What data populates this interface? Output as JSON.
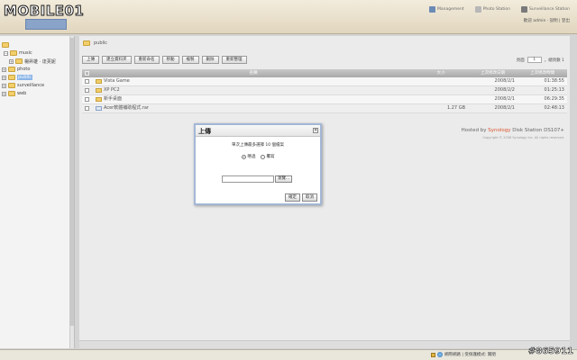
{
  "header": {
    "logo_text": "MOBILE01",
    "logo_sub": "",
    "links": [
      {
        "label": "Management",
        "icon": "management-icon",
        "color": "#6b8bb5"
      },
      {
        "label": "Photo Station",
        "icon": "photo-icon",
        "color": "#b7b7b7"
      },
      {
        "label": "Surveillance Station",
        "icon": "surveillance-icon",
        "color": "#7a7a7a"
      }
    ],
    "user_line": "歡迎 admin · 說明 | 登出"
  },
  "tree": {
    "items": [
      {
        "label": "",
        "level": 0,
        "icon": "folder-icon"
      },
      {
        "label": "music",
        "level": 1,
        "icon": "folder-icon"
      },
      {
        "label": "楊昇雄 · 達芙妮",
        "level": 2,
        "icon": "folder-icon"
      },
      {
        "label": "photo",
        "level": 1,
        "icon": "folder-icon"
      },
      {
        "label": "public",
        "level": 1,
        "icon": "folder-icon",
        "selected": true
      },
      {
        "label": "surveillance",
        "level": 1,
        "icon": "folder-icon"
      },
      {
        "label": "web",
        "level": 1,
        "icon": "folder-icon"
      }
    ]
  },
  "main": {
    "path": "public",
    "toolbar": [
      "上傳",
      "建立資料夾",
      "重新命名",
      "移動",
      "複製",
      "刪除",
      "重新整理"
    ],
    "pager": {
      "prefix": "頁面",
      "page": "1",
      "suffix": "，總頁數 1"
    },
    "columns": {
      "name": "名稱",
      "size": "大小",
      "date": "上次修改日期",
      "time": "上次修改時間"
    },
    "rows": [
      {
        "name": "Vista Game",
        "type": "folder",
        "size": "",
        "date": "2008/2/1",
        "time": "01:38:55"
      },
      {
        "name": "XP PC2",
        "type": "folder",
        "size": "",
        "date": "2008/2/2",
        "time": "01:25:13"
      },
      {
        "name": "新手桌面",
        "type": "folder",
        "size": "",
        "date": "2008/2/1",
        "time": "06:29:35"
      },
      {
        "name": "Acer軟體補助程式.rar",
        "type": "file",
        "size": "1.27 GB",
        "date": "2008/2/1",
        "time": "02:48:13"
      }
    ],
    "hosted_prefix": "Hosted by ",
    "hosted_brand": "Synology",
    "hosted_suffix": " Disk Station DS107+",
    "copyright": "Copyright © 2008 Synology Inc. All rights reserved."
  },
  "dialog": {
    "title": "上傳",
    "message": "單次上傳最多選擇 10 個檔案",
    "radio_on_label": "略過",
    "radio_off_label": "覆寫",
    "browse_label": "瀏覽...",
    "ok_label": "確定",
    "cancel_label": "取消"
  },
  "statusbar": {
    "zone_label": "網際網路 | 受保護模式: 關閉",
    "zoom": ""
  },
  "watermark": "#865911"
}
